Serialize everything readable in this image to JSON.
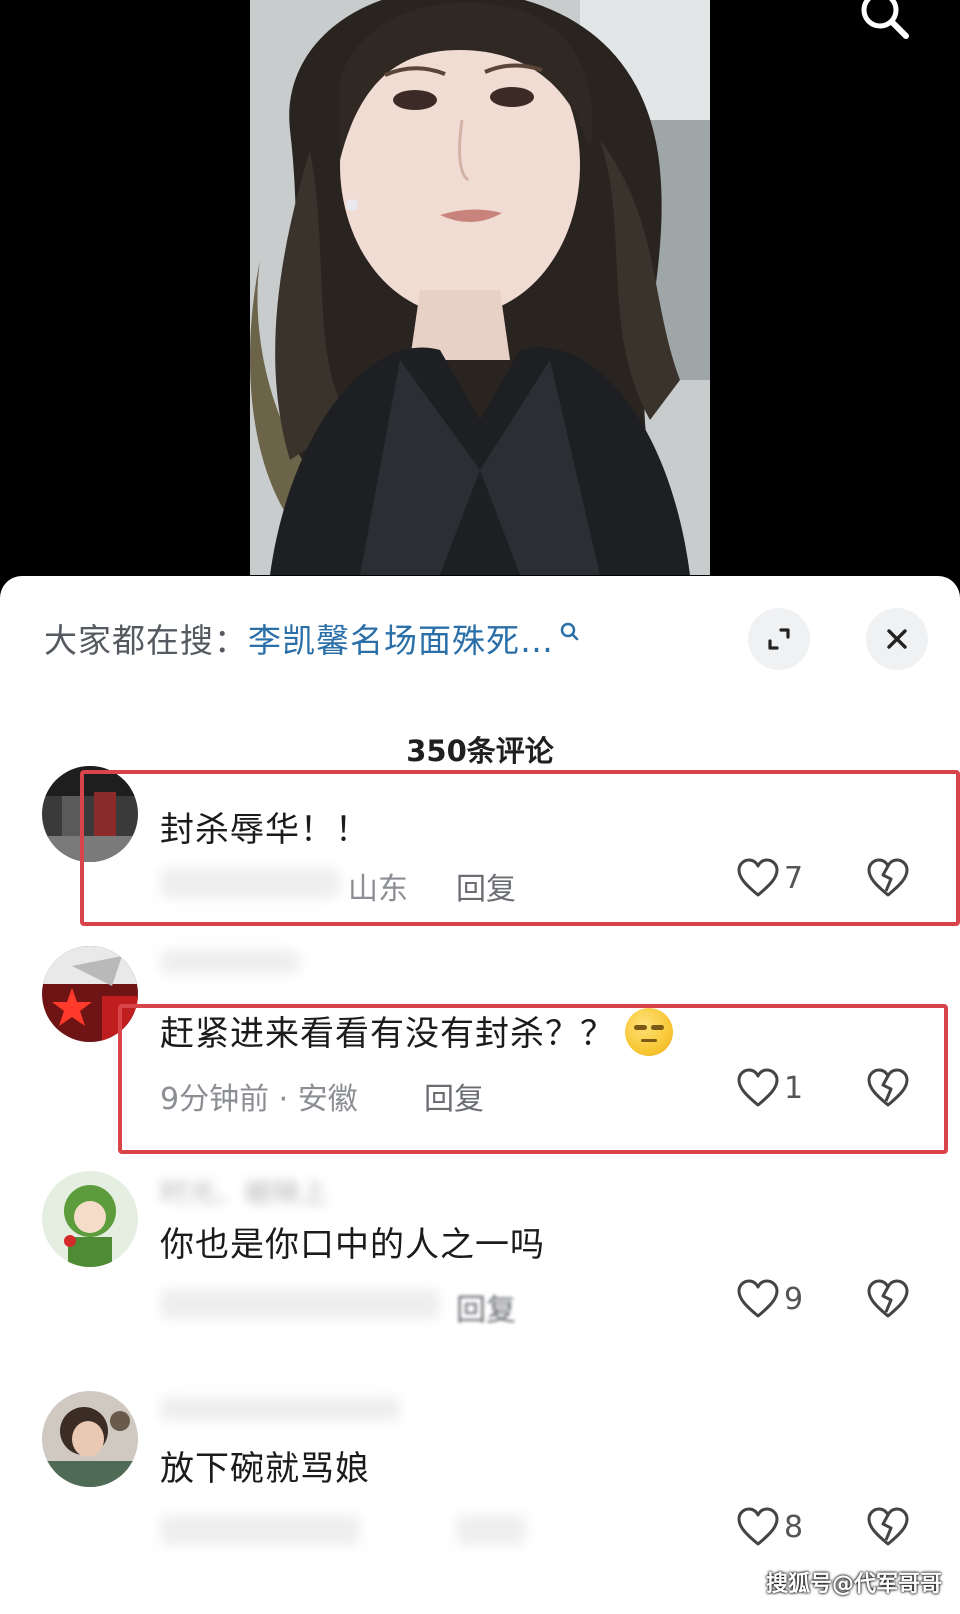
{
  "search_bar": {
    "prefix": "大家都在搜：",
    "query": "李凯馨名场面殊死…"
  },
  "comments_header": {
    "count_label": "350条评论"
  },
  "comments": [
    {
      "text": "封杀辱华！！",
      "location_visible": "山东",
      "reply_label": "回复",
      "likes": "7"
    },
    {
      "text": "赶紧进来看看有没有封杀？？",
      "time": "9分钟前",
      "location": "安徽",
      "reply_label": "回复",
      "likes": "1",
      "emoji": "unamused-face-emoji"
    },
    {
      "author_partial": "时光、被映上",
      "text": "你也是你口中的人之一吗",
      "reply_label": "回复",
      "likes": "9"
    },
    {
      "text": "放下碗就骂娘",
      "likes": "8"
    }
  ],
  "watermark": "搜狐号@代军哥哥",
  "colors": {
    "link_blue": "#2b6fa8",
    "highlight_red": "#d9434a",
    "sheet_bg": "#ffffff"
  },
  "icons": {
    "top_search": "search-icon",
    "expand": "expand-icon",
    "close": "close-icon",
    "like": "heart-icon",
    "dislike": "broken-heart-icon"
  }
}
